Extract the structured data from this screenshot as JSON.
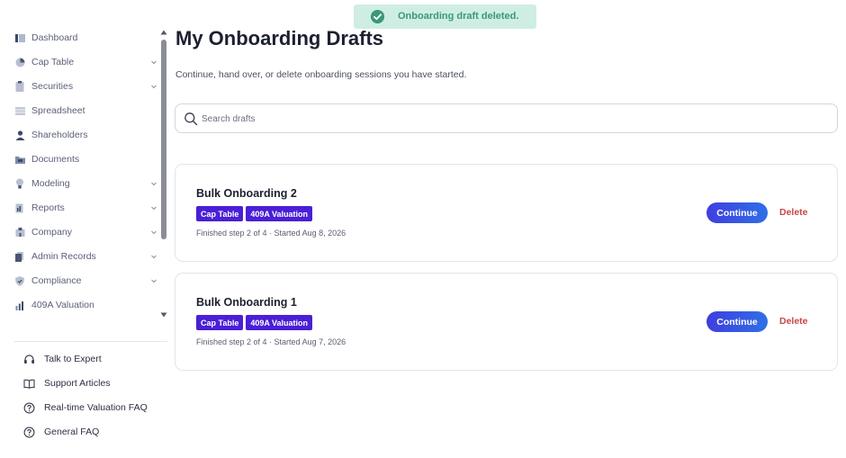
{
  "colors": {
    "accent": "#4a1fd6",
    "continue_button": "#3f3ee0",
    "delete_text": "#c94545",
    "toast_bg": "#cfeee3",
    "toast_text": "#3a9878"
  },
  "toast": {
    "icon": "check-circle-icon",
    "message": "Onboarding draft deleted."
  },
  "sidebar": {
    "items": [
      {
        "label": "Dashboard",
        "icon": "dashboard-icon",
        "has_chevron": false
      },
      {
        "label": "Cap Table",
        "icon": "pie-chart-icon",
        "has_chevron": true
      },
      {
        "label": "Securities",
        "icon": "clipboard-icon",
        "has_chevron": true
      },
      {
        "label": "Spreadsheet",
        "icon": "spreadsheet-icon",
        "has_chevron": false
      },
      {
        "label": "Shareholders",
        "icon": "person-icon",
        "has_chevron": false
      },
      {
        "label": "Documents",
        "icon": "folder-icon",
        "has_chevron": false
      },
      {
        "label": "Modeling",
        "icon": "lightbulb-icon",
        "has_chevron": true
      },
      {
        "label": "Reports",
        "icon": "report-icon",
        "has_chevron": true
      },
      {
        "label": "Company",
        "icon": "building-icon",
        "has_chevron": true
      },
      {
        "label": "Admin Records",
        "icon": "records-icon",
        "has_chevron": true
      },
      {
        "label": "Compliance",
        "icon": "shield-check-icon",
        "has_chevron": true
      },
      {
        "label": "409A Valuation",
        "icon": "valuation-icon",
        "has_chevron": false
      }
    ],
    "help": [
      {
        "label": "Talk to Expert",
        "icon": "headset-icon"
      },
      {
        "label": "Support Articles",
        "icon": "book-icon"
      },
      {
        "label": "Real-time Valuation FAQ",
        "icon": "question-circle-icon"
      },
      {
        "label": "General FAQ",
        "icon": "question-circle-icon"
      }
    ]
  },
  "main": {
    "title": "My Onboarding Drafts",
    "subtitle": "Continue, hand over, or delete onboarding sessions you have started.",
    "search": {
      "placeholder": "Search drafts",
      "value": ""
    },
    "drafts": [
      {
        "title": "Bulk Onboarding 2",
        "tags": [
          "Cap Table",
          "409A Valuation"
        ],
        "meta": "Finished step 2 of 4 · Started Aug 8, 2026",
        "continue_label": "Continue",
        "delete_label": "Delete"
      },
      {
        "title": "Bulk Onboarding 1",
        "tags": [
          "Cap Table",
          "409A Valuation"
        ],
        "meta": "Finished step 2 of 4 · Started Aug 7, 2026",
        "continue_label": "Continue",
        "delete_label": "Delete"
      }
    ]
  }
}
